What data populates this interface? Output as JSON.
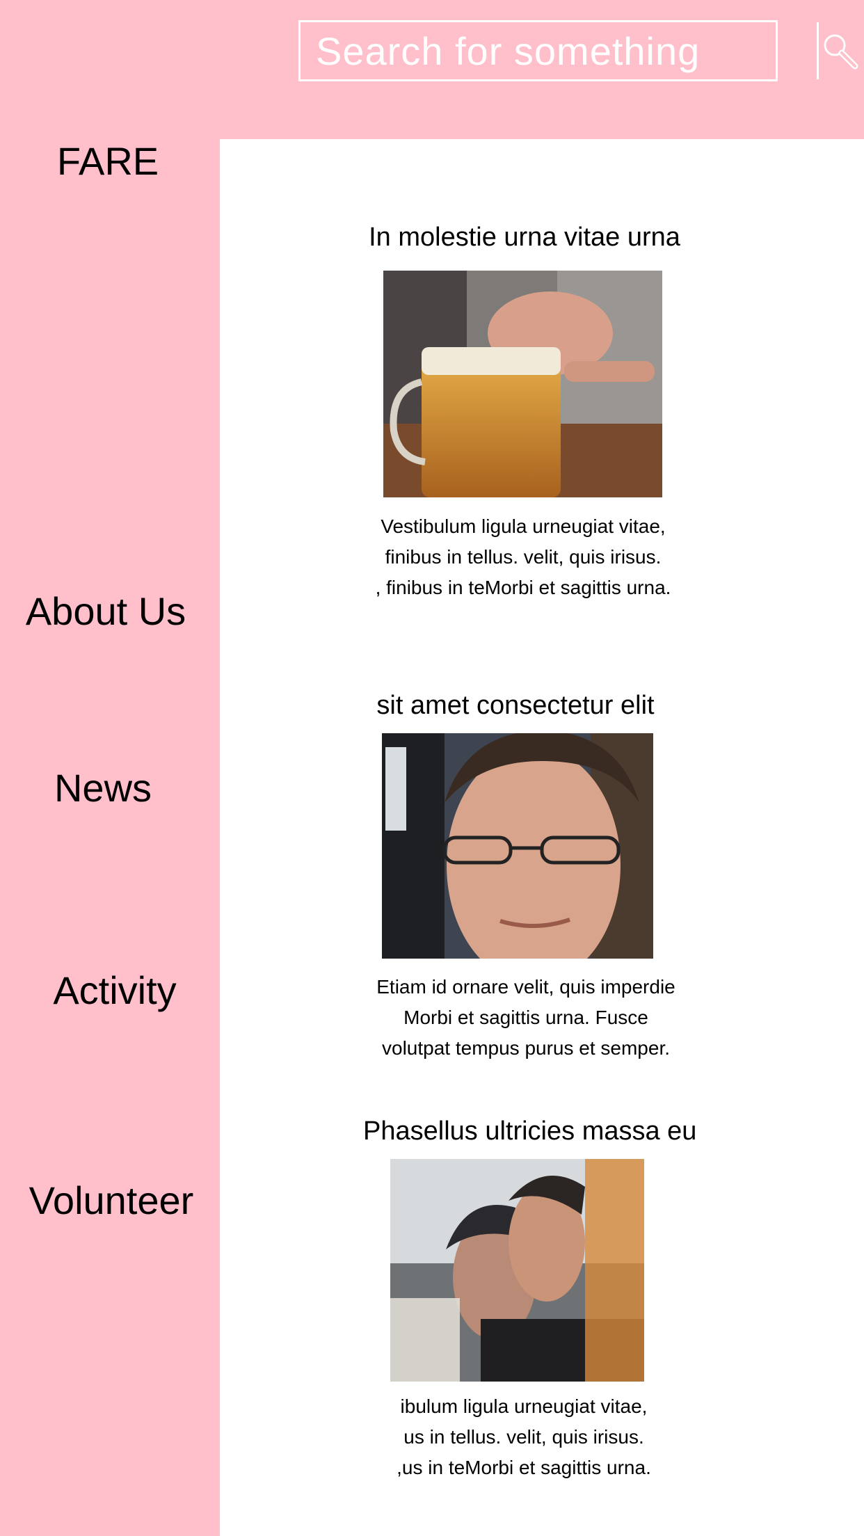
{
  "search": {
    "placeholder": "Search for something",
    "button_icon": "search-icon"
  },
  "brand": {
    "logo": "FARE"
  },
  "nav": {
    "items": [
      {
        "label": "About Us"
      },
      {
        "label": "News"
      },
      {
        "label": "Activity"
      },
      {
        "label": "Volunteer"
      }
    ]
  },
  "colors": {
    "sidebar": "#ffbfcb",
    "main": "#ffffff",
    "text": "#000000",
    "search_border": "#ffffff"
  },
  "cards": [
    {
      "title": "In molestie urna vitae urna",
      "image": "beer-mug-refusal-photo",
      "lines": [
        "Vestibulum ligula urneugiat vitae,",
        "finibus in tellus.  velit, quis irisus.",
        ", finibus in teMorbi et sagittis urna."
      ]
    },
    {
      "title": "sit amet consectetur elit",
      "image": "man-with-glasses-portrait-photo",
      "lines": [
        "Etiam id ornare velit, quis imperdie",
        "Morbi et sagittis urna. Fusce",
        "volutpat tempus purus et semper."
      ]
    },
    {
      "title": "Phasellus ultricies massa eu",
      "image": "men-drinking-beer-photo",
      "lines": [
        "ibulum ligula urneugiat vitae,",
        "us in tellus.  velit, quis irisus.",
        ",us in teMorbi et sagittis urna."
      ]
    }
  ]
}
